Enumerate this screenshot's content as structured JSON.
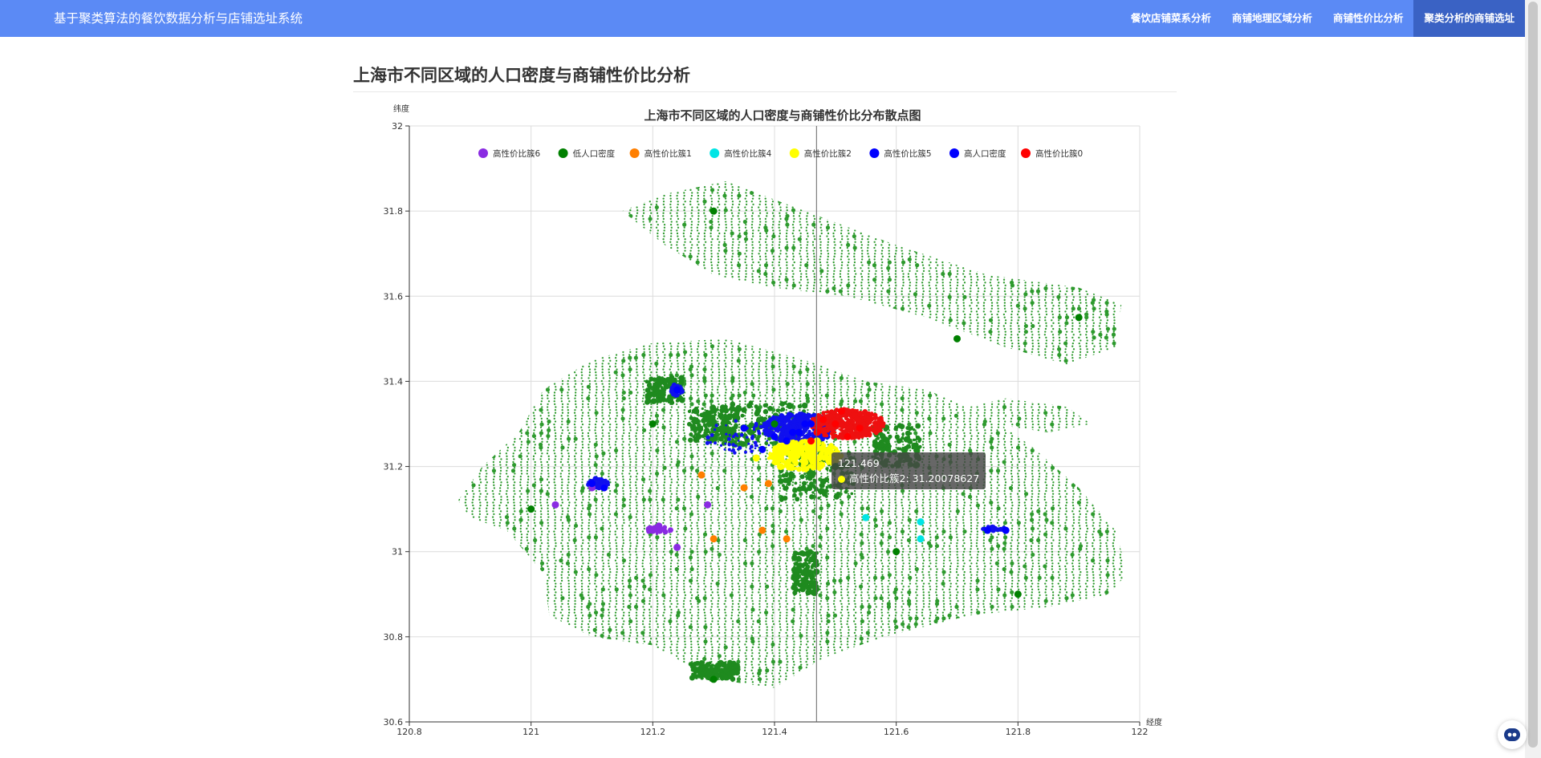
{
  "app": {
    "title": "基于聚类算法的餐饮数据分析与店铺选址系统",
    "nav": [
      {
        "label": "餐饮店铺菜系分析",
        "active": false
      },
      {
        "label": "商铺地理区域分析",
        "active": false
      },
      {
        "label": "商铺性价比分析",
        "active": false
      },
      {
        "label": "聚类分析的商铺选址",
        "active": true
      }
    ]
  },
  "page": {
    "heading": "上海市不同区域的人口密度与商铺性价比分析"
  },
  "chart_data": {
    "type": "scatter",
    "title": "上海市不同区域的人口密度与商铺性价比分布散点图",
    "xlabel": "经度",
    "ylabel": "纬度",
    "xlim": [
      120.8,
      122
    ],
    "ylim": [
      30.6,
      32
    ],
    "xticks": [
      "120.8",
      "121",
      "121.2",
      "121.4",
      "121.6",
      "121.8",
      "122"
    ],
    "yticks": [
      "30.6",
      "30.8",
      "31",
      "31.2",
      "31.4",
      "31.6",
      "31.8",
      "32"
    ],
    "grid": true,
    "legend_position": "top",
    "series": [
      {
        "name": "高性价比簇6",
        "color": "#8a2be2",
        "points": [
          [
            121.1,
            31.15
          ],
          [
            121.12,
            31.15
          ],
          [
            121.2,
            31.05
          ],
          [
            121.24,
            31.01
          ],
          [
            121.21,
            31.06
          ],
          [
            121.04,
            31.11
          ],
          [
            121.29,
            31.11
          ]
        ]
      },
      {
        "name": "低人口密度",
        "color": "#008000",
        "points": [
          [
            121.4,
            31.3
          ],
          [
            121.6,
            31.0
          ],
          [
            121.0,
            31.1
          ],
          [
            121.3,
            30.7
          ],
          [
            121.7,
            31.5
          ],
          [
            121.9,
            31.55
          ],
          [
            121.3,
            31.8
          ],
          [
            121.2,
            31.3
          ],
          [
            121.5,
            31.2
          ],
          [
            121.8,
            30.9
          ]
        ]
      },
      {
        "name": "高性价比簇1",
        "color": "#ff7f00",
        "points": [
          [
            121.39,
            31.16
          ],
          [
            121.35,
            31.15
          ],
          [
            121.28,
            31.18
          ],
          [
            121.42,
            31.03
          ],
          [
            121.3,
            31.03
          ],
          [
            121.38,
            31.05
          ]
        ]
      },
      {
        "name": "高性价比簇4",
        "color": "#00e5e5",
        "points": [
          [
            121.64,
            31.03
          ],
          [
            121.55,
            31.08
          ],
          [
            121.64,
            31.07
          ]
        ]
      },
      {
        "name": "高性价比簇2",
        "color": "#ffff00",
        "points": [
          [
            121.469,
            31.20078627
          ],
          [
            121.43,
            31.22
          ],
          [
            121.46,
            31.23
          ],
          [
            121.48,
            31.24
          ],
          [
            121.41,
            31.2
          ],
          [
            121.45,
            31.21
          ],
          [
            121.47,
            31.26
          ],
          [
            121.37,
            31.22
          ]
        ]
      },
      {
        "name": "高性价比簇5",
        "color": "#0000ff",
        "points": [
          [
            121.1,
            31.16
          ],
          [
            121.12,
            31.15
          ],
          [
            121.24,
            31.38
          ],
          [
            121.75,
            31.05
          ],
          [
            121.78,
            31.05
          ],
          [
            121.45,
            31.3
          ],
          [
            121.43,
            31.28
          ],
          [
            121.38,
            31.24
          ]
        ]
      },
      {
        "name": "高人口密度",
        "color": "#0000ff",
        "points": [
          [
            121.44,
            31.28
          ],
          [
            121.46,
            31.3
          ],
          [
            121.42,
            31.26
          ],
          [
            121.4,
            31.27
          ],
          [
            121.35,
            31.29
          ]
        ]
      },
      {
        "name": "高性价比簇0",
        "color": "#ff0000",
        "points": [
          [
            121.47,
            31.28
          ],
          [
            121.5,
            31.3
          ],
          [
            121.48,
            31.31
          ],
          [
            121.52,
            31.27
          ],
          [
            121.46,
            31.26
          ],
          [
            121.54,
            31.29
          ],
          [
            121.51,
            31.33
          ]
        ]
      }
    ],
    "tooltip": {
      "x_label": "121.469",
      "series_name": "高性价比簇2",
      "value": "31.20078627"
    }
  }
}
